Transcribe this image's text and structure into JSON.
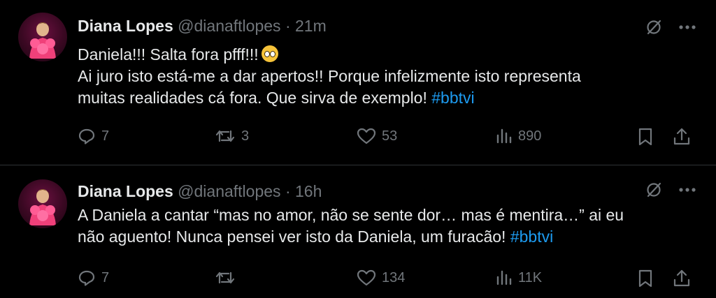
{
  "tweets": [
    {
      "author_name": "Diana Lopes",
      "handle": "@dianaftlopes",
      "separator": "·",
      "time": "21m",
      "lines": [
        "Daniela!!! Salta fora pfff!!!",
        "Ai juro isto está-me a dar apertos!! Porque infelizmente isto representa",
        "muitas realidades cá fora. Que sirva de exemplo!"
      ],
      "hashtag": "#bbtvi",
      "replies": "7",
      "reposts": "3",
      "likes": "53",
      "views": "890"
    },
    {
      "author_name": "Diana Lopes",
      "handle": "@dianaftlopes",
      "separator": "·",
      "time": "16h",
      "lines": [
        "A Daniela a cantar “mas no amor, não se sente dor… mas é mentira…” ai eu",
        "não aguento! Nunca pensei ver isto da Daniela, um furacão!"
      ],
      "hashtag": "#bbtvi",
      "replies": "7",
      "reposts": "",
      "likes": "134",
      "views": "11K"
    }
  ],
  "colors": {
    "background": "#000000",
    "text": "#e7e9ea",
    "muted": "#71767b",
    "link": "#1d9bf0",
    "divider": "#2f3336"
  },
  "icons": [
    "grok-icon",
    "more-icon",
    "reply-icon",
    "repost-icon",
    "like-icon",
    "views-icon",
    "bookmark-icon",
    "share-icon",
    "crying-face-emoji"
  ]
}
